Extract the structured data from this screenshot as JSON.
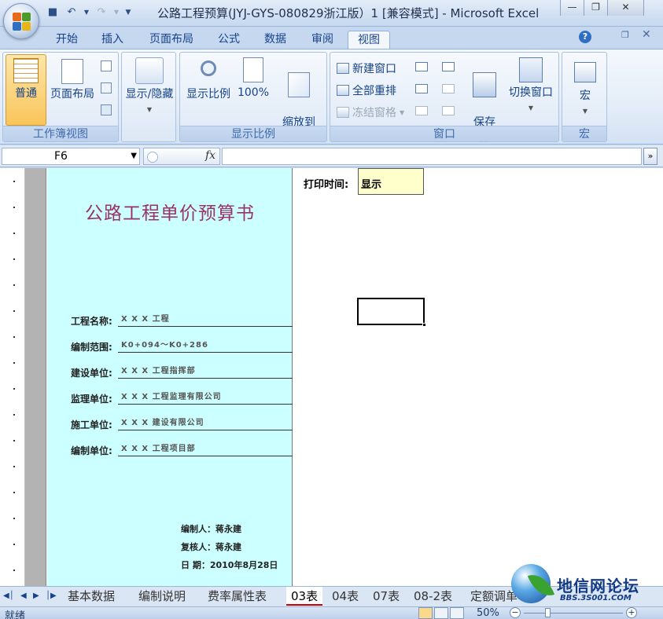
{
  "window": {
    "title": "公路工程预算(JYJ-GYS-080829浙江版）1  [兼容模式] - Microsoft Excel"
  },
  "ribbon_tabs": [
    "开始",
    "插入",
    "页面布局",
    "公式",
    "数据",
    "审阅",
    "视图"
  ],
  "active_tab": "视图",
  "ribbon": {
    "workbook_views": {
      "label": "工作簿视图",
      "normal": "普通",
      "page_layout": "页面布局"
    },
    "show_hide": {
      "label": "显示/隐藏"
    },
    "zoom_group": {
      "label": "显示比例",
      "zoom": "显示比例",
      "zoom100": "100%",
      "zoom_selection": "缩放到\n选定区域"
    },
    "window_group": {
      "label": "窗口",
      "new_window": "新建窗口",
      "arrange_all": "全部重排",
      "freeze_panes": "冻结窗格",
      "save_workspace": "保存\n工作区",
      "switch_windows": "切换窗口"
    },
    "macros_group": {
      "label": "宏",
      "macros": "宏"
    }
  },
  "formula_bar": {
    "name_box": "F6",
    "fx": "fx",
    "formula": ""
  },
  "sheet": {
    "cover_title": "公路工程单价预算书",
    "fields": [
      {
        "label": "工程名称:",
        "value": "X X X 工程"
      },
      {
        "label": "编制范围:",
        "value": "K0+094～K0+286"
      },
      {
        "label": "建设单位:",
        "value": "X X X 工程指挥部"
      },
      {
        "label": "监理单位:",
        "value": "X X X 工程监理有限公司"
      },
      {
        "label": "施工单位:",
        "value": "X X X 建设有限公司"
      },
      {
        "label": "编制单位:",
        "value": "X X X 工程项目部"
      }
    ],
    "compiler": "编制人：蒋永建",
    "reviewer": "复核人：蒋永建",
    "date": "日    期：2010年8月28日",
    "print_time_label": "打印时间:",
    "print_time_value": "显示"
  },
  "sheet_tabs": [
    "基本数据",
    "编制说明",
    "费率属性表",
    "03表",
    "04表",
    "07表",
    "08-2表",
    "定额调单"
  ],
  "active_sheet": "03表",
  "status": {
    "ready": "就绪",
    "zoom": "50%"
  },
  "watermark": {
    "name": "地信网论坛",
    "url": "BBS.3S001.COM"
  },
  "colors": {
    "cover_bg": "#ccffff",
    "cover_title": "#993366",
    "print_box_bg": "#ffffcc",
    "ribbon_text": "#15428b"
  }
}
